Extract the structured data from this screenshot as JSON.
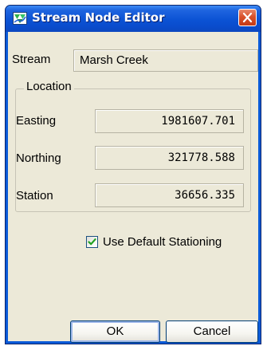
{
  "window": {
    "title": "Stream Node Editor",
    "app_icon": "stream-editor-icon",
    "close_icon": "close-icon"
  },
  "stream": {
    "label": "Stream",
    "value": "Marsh Creek"
  },
  "location": {
    "group_label": "Location",
    "easting": {
      "label": "Easting",
      "value": "1981607.701"
    },
    "northing": {
      "label": "Northing",
      "value": "321778.588"
    },
    "station": {
      "label": "Station",
      "value": "36656.335"
    }
  },
  "options": {
    "use_default_stationing_label": "Use Default Stationing",
    "use_default_stationing_checked": true
  },
  "buttons": {
    "ok_label": "OK",
    "cancel_label": "Cancel"
  },
  "colors": {
    "titlebar": "#0b52d4",
    "close_button": "#d9512b",
    "dialog_background": "#ece9d8",
    "field_background": "#ece9d8"
  }
}
